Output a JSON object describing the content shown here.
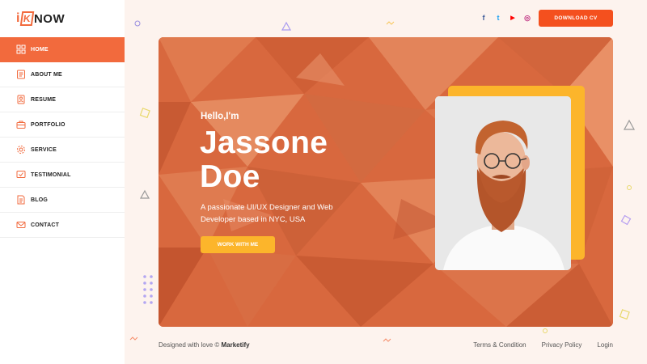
{
  "brand": {
    "logo_prefix": "i",
    "logo_k": "K",
    "logo_suffix": "NOW"
  },
  "sidebar": {
    "items": [
      {
        "label": "HOME",
        "icon": "grid-icon",
        "active": true
      },
      {
        "label": "ABOUT ME",
        "icon": "id-card-icon",
        "active": false
      },
      {
        "label": "RESUME",
        "icon": "resume-icon",
        "active": false
      },
      {
        "label": "PORTFOLIO",
        "icon": "briefcase-icon",
        "active": false
      },
      {
        "label": "SERVICE",
        "icon": "gear-icon",
        "active": false
      },
      {
        "label": "TESTIMONIAL",
        "icon": "chat-check-icon",
        "active": false
      },
      {
        "label": "BLOG",
        "icon": "document-icon",
        "active": false
      },
      {
        "label": "CONTACT",
        "icon": "envelope-icon",
        "active": false
      }
    ]
  },
  "header": {
    "socials": [
      {
        "name": "facebook-icon",
        "glyph": "f",
        "color": "#3b5998"
      },
      {
        "name": "twitter-icon",
        "glyph": "t",
        "color": "#1da1f2"
      },
      {
        "name": "youtube-icon",
        "glyph": "▶",
        "color": "#ff0000"
      },
      {
        "name": "instagram-icon",
        "glyph": "◎",
        "color": "#c13584"
      }
    ],
    "cta_label": "DOWNLOAD CV"
  },
  "hero": {
    "greeting": "Hello,I'm",
    "name_line1": "Jassone",
    "name_line2": "Doe",
    "tagline_line1": "A passionate UI/UX Designer and Web",
    "tagline_line2": "Developer based in NYC, USA",
    "button_label": "WORK WITH ME"
  },
  "footer": {
    "credit_prefix": "Designed with love ©",
    "credit_brand": "Marketify",
    "links": [
      "Terms & Condition",
      "Privacy Policy",
      "Login"
    ]
  },
  "colors": {
    "accent": "#f26a3d",
    "cta": "#f4501e",
    "yellow": "#fcb52b",
    "background": "#fdf3ee"
  }
}
